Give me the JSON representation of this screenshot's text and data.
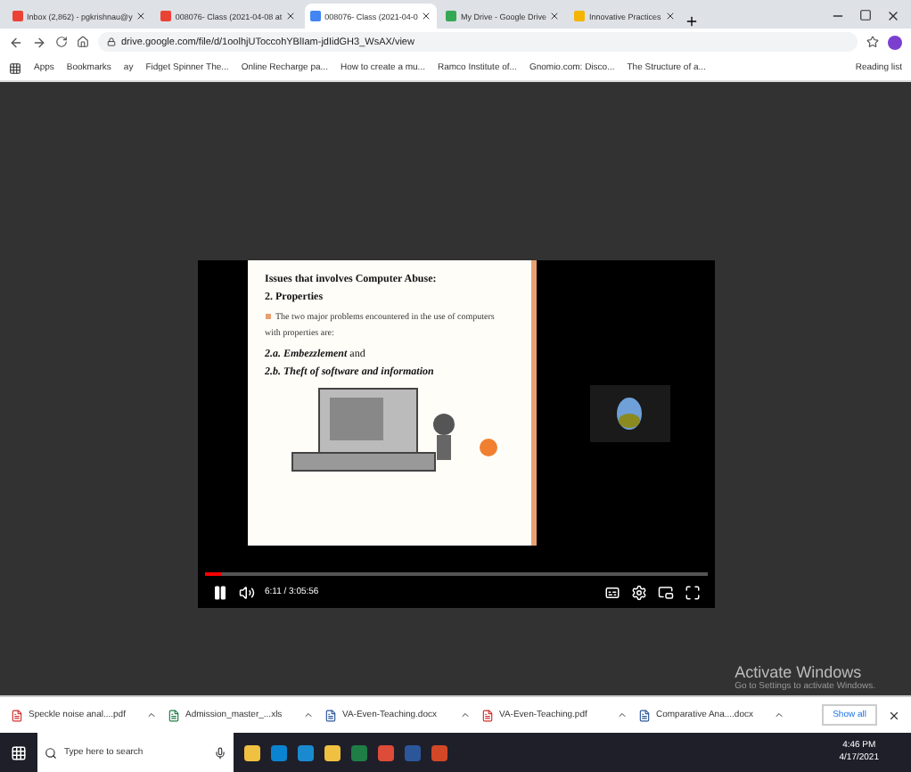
{
  "tabs": [
    {
      "label": "Inbox (2,862) - pgkrishnau@y",
      "selected": false
    },
    {
      "label": "008076- Class (2021-04-08 at",
      "selected": false
    },
    {
      "label": "008076- Class (2021-04-0",
      "selected": true
    },
    {
      "label": "My Drive - Google Drive",
      "selected": false
    },
    {
      "label": "Innovative Practices",
      "selected": false
    }
  ],
  "address": {
    "url": "drive.google.com/file/d/1oolhjUToccohYBlIam-jdIidGH3_WsAX/view"
  },
  "bookmarks": [
    "Apps",
    "Bookmarks",
    "ay",
    "Fidget Spinner The...",
    "Online Recharge pa...",
    "How to create a mu...",
    "Ramco Institute of...",
    "Gnomio.com: Disco...",
    "The Structure of a..."
  ],
  "reading_list": "Reading list",
  "slide": {
    "title": "Issues that involves Computer Abuse:",
    "heading": "2. Properties",
    "bullet": "The two major problems encountered in the use of computers with properties are:",
    "items": [
      "**2.a. Embezzlement** and",
      "2.b. Theft of software and information"
    ]
  },
  "player": {
    "playing": true,
    "level": 0.033,
    "time": "6:11 / 3:05:56"
  },
  "watermark": {
    "title": "Activate Windows",
    "subtitle": "Go to Settings to activate Windows."
  },
  "downloads": {
    "files": [
      "Speckle noise anal....pdf",
      "Admission_master_...xls",
      "VA-Even-Teaching.docx",
      "VA-Even-Teaching.pdf",
      "Comparative Ana....docx"
    ],
    "show_all": "Show all"
  },
  "taskbar": {
    "search_placeholder": "Type here to search",
    "time": "4:46 PM",
    "date": "4/17/2021"
  }
}
